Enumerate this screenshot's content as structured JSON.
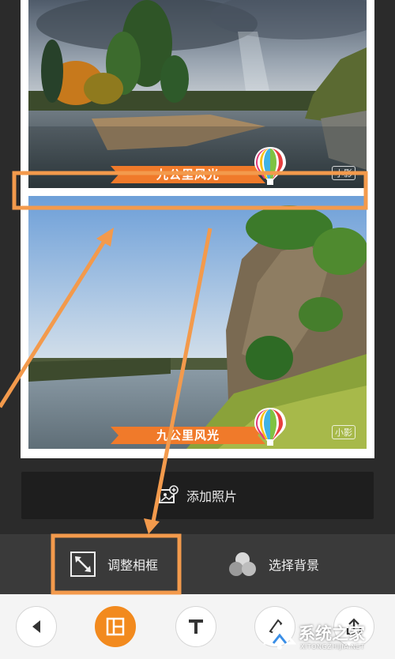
{
  "photos": [
    {
      "caption": "九公里风光",
      "video_tag": "小影"
    },
    {
      "caption": "九公里风光",
      "video_tag": "小影"
    }
  ],
  "add_photo": {
    "label": "添加照片",
    "icon": "add-photo-icon"
  },
  "tools": {
    "adjust_frame": {
      "label": "调整相框",
      "icon": "resize-frame-icon"
    },
    "select_background": {
      "label": "选择背景",
      "icon": "background-circles-icon"
    }
  },
  "bottom_nav": [
    {
      "name": "back",
      "icon": "back-arrow-icon"
    },
    {
      "name": "layout",
      "icon": "layout-grid-icon",
      "active": true
    },
    {
      "name": "text",
      "icon": "text-icon"
    },
    {
      "name": "sticker",
      "icon": "sticker-icon"
    },
    {
      "name": "share",
      "icon": "share-icon"
    }
  ],
  "watermark": {
    "brand": "系统之家",
    "url": "XITONGZHIJIA.NET"
  },
  "colors": {
    "accent": "#f28a1e",
    "annotation": "#f39a4c",
    "banner": "#f07a2a",
    "toolbar": "#3a3a3a",
    "bottom_nav": "#f4f4f4"
  }
}
